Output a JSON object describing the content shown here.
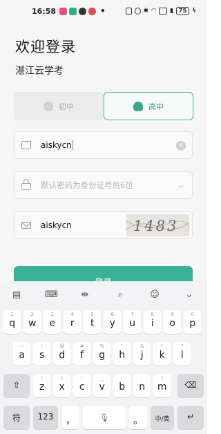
{
  "status_bar": {
    "time": "16:58",
    "battery": "75"
  },
  "page": {
    "title": "欢迎登录",
    "subtitle": "湛江云学考"
  },
  "tabs": [
    {
      "label": "初中",
      "selected": false
    },
    {
      "label": "高中",
      "selected": true
    }
  ],
  "form": {
    "username_value": "aiskycn",
    "password_placeholder": "默认密码为身份证号后6位",
    "captcha_value": "aiskycn",
    "captcha_image_text": "1483"
  },
  "login_button": {
    "label": "登录"
  },
  "keyboard": {
    "row1": [
      {
        "main": "q",
        "hint": "1"
      },
      {
        "main": "w",
        "hint": "2"
      },
      {
        "main": "e",
        "hint": "3"
      },
      {
        "main": "r",
        "hint": "4"
      },
      {
        "main": "t",
        "hint": "5"
      },
      {
        "main": "y",
        "hint": "6"
      },
      {
        "main": "u",
        "hint": "7"
      },
      {
        "main": "i",
        "hint": "8"
      },
      {
        "main": "o",
        "hint": "9"
      },
      {
        "main": "p",
        "hint": "0"
      }
    ],
    "row2": [
      {
        "main": "a",
        "hint": "~"
      },
      {
        "main": "s",
        "hint": "!"
      },
      {
        "main": "d",
        "hint": "@"
      },
      {
        "main": "f",
        "hint": "#"
      },
      {
        "main": "g",
        "hint": "%"
      },
      {
        "main": "h",
        "hint": "'"
      },
      {
        "main": "j",
        "hint": "&"
      },
      {
        "main": "k",
        "hint": "*"
      },
      {
        "main": "l",
        "hint": "?"
      }
    ],
    "row3": [
      {
        "main": "z",
        "hint": "("
      },
      {
        "main": "x",
        "hint": ")"
      },
      {
        "main": "c",
        "hint": "-"
      },
      {
        "main": "v",
        "hint": "_"
      },
      {
        "main": "b",
        "hint": ":"
      },
      {
        "main": "n",
        "hint": ";"
      },
      {
        "main": "m",
        "hint": "/"
      }
    ],
    "shift": "⇧",
    "backspace": "⌫",
    "symbols": "符",
    "numbers": "123",
    "comma": "，",
    "mic": "🎙",
    "period": "。",
    "lang": "中/英",
    "enter": "↵"
  }
}
